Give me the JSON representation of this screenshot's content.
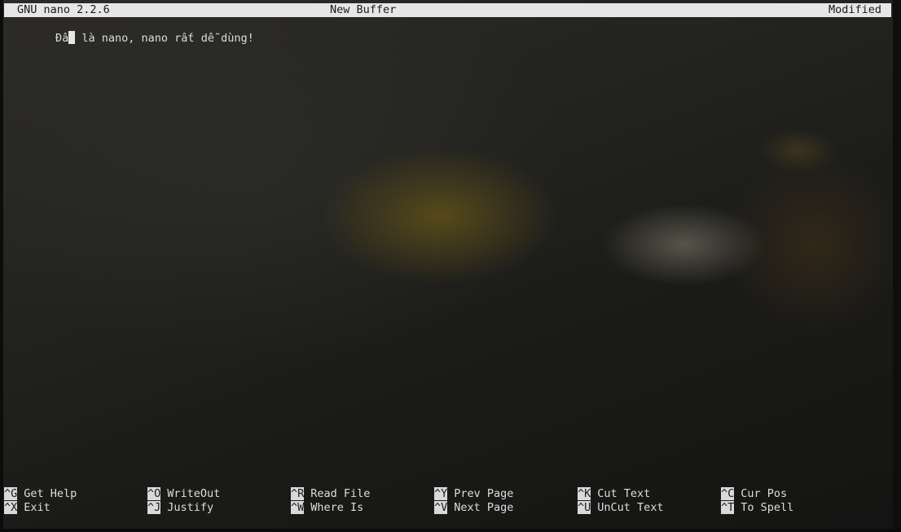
{
  "titlebar": {
    "app": "GNU nano 2.2.6",
    "buffer": "New Buffer",
    "status": "Modified"
  },
  "editor": {
    "before_cursor": "Đâ",
    "after_cursor": " là nano, nano rất dễ dùng!"
  },
  "shortcuts": {
    "row1": [
      {
        "key": "^G",
        "label": "Get Help"
      },
      {
        "key": "^O",
        "label": "WriteOut"
      },
      {
        "key": "^R",
        "label": "Read File"
      },
      {
        "key": "^Y",
        "label": "Prev Page"
      },
      {
        "key": "^K",
        "label": "Cut Text"
      },
      {
        "key": "^C",
        "label": "Cur Pos"
      }
    ],
    "row2": [
      {
        "key": "^X",
        "label": "Exit"
      },
      {
        "key": "^J",
        "label": "Justify"
      },
      {
        "key": "^W",
        "label": "Where Is"
      },
      {
        "key": "^V",
        "label": "Next Page"
      },
      {
        "key": "^U",
        "label": "UnCut Text"
      },
      {
        "key": "^T",
        "label": "To Spell"
      }
    ]
  }
}
